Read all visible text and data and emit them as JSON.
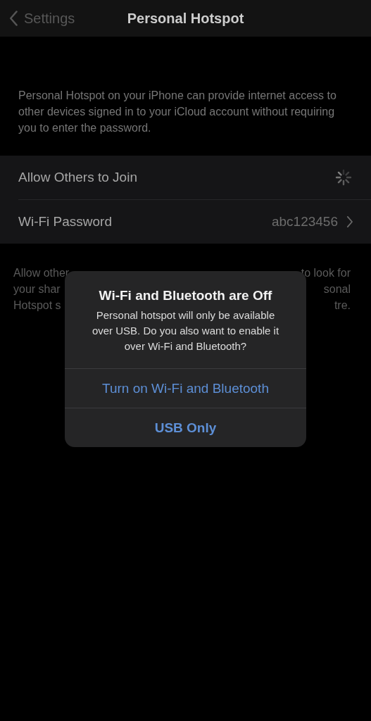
{
  "nav": {
    "back": "Settings",
    "title": "Personal Hotspot"
  },
  "intro": "Personal Hotspot on your iPhone can provide internet access to other devices signed in to your iCloud account without requiring you to enter the password.",
  "rows": [
    {
      "kind": "spinner",
      "label": "Allow Others to Join"
    },
    {
      "kind": "link",
      "label": "Wi-Fi Password",
      "value": "abc123456"
    }
  ],
  "footer_fragments": [
    {
      "left": "Allow other",
      "right": "to look for"
    },
    {
      "left": "your shar",
      "right": "sonal"
    },
    {
      "left": "Hotspot s",
      "right": "tre."
    }
  ],
  "alert": {
    "title": "Wi-Fi and Bluetooth are Off",
    "message": "Personal hotspot will only be available over USB. Do you also want to enable it over Wi-Fi and Bluetooth?",
    "actions": [
      {
        "label": "Turn on Wi-Fi and Bluetooth",
        "preferred": false
      },
      {
        "label": "USB Only",
        "preferred": true
      }
    ]
  }
}
